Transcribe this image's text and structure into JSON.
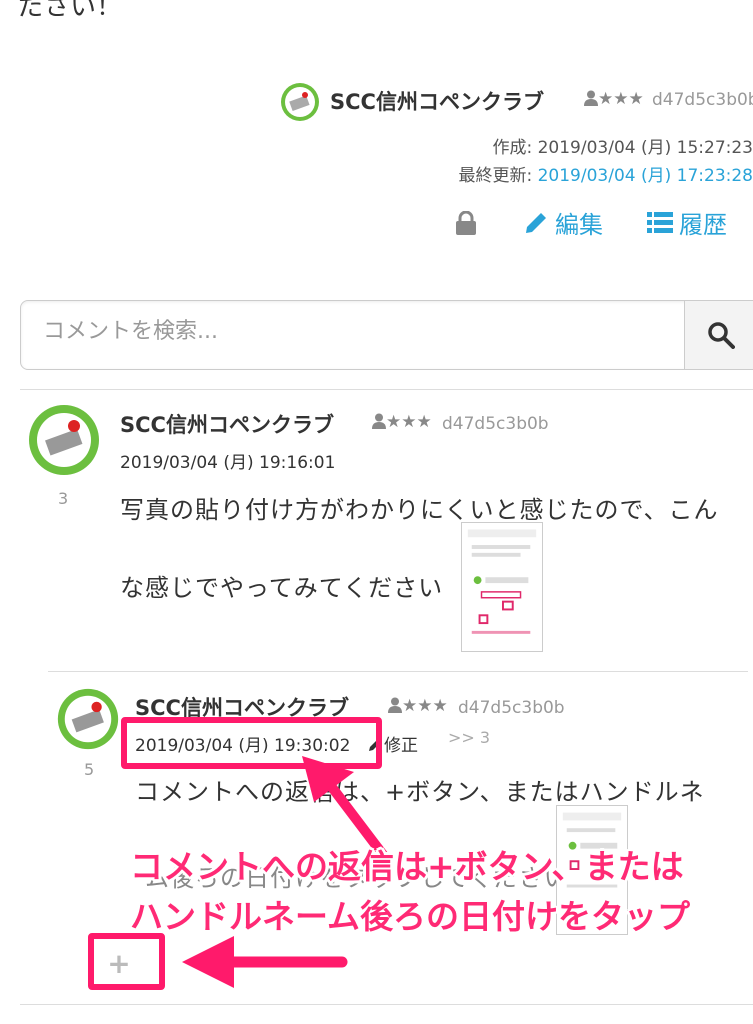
{
  "page": {
    "top_text": "ださい！"
  },
  "post_author": {
    "name": "SCC信州コペンクラブ",
    "badge": "★★★",
    "id": "d47d5c3b0b",
    "created_label": "作成: ",
    "created_value": "2019/03/04 (月) 15:27:23",
    "updated_label": "最終更新: ",
    "updated_value": "2019/03/04 (月) 17:23:28"
  },
  "actions": {
    "lock_icon": "lock-icon",
    "edit_label": "編集",
    "history_label": "履歴"
  },
  "search": {
    "placeholder": "コメントを検索...",
    "icon": "search-icon"
  },
  "comments": [
    {
      "name": "SCC信州コペンクラブ",
      "badge": "★★★",
      "id": "d47d5c3b0b",
      "date": "2019/03/04 (月) 19:16:01",
      "count": "3",
      "body_line1": "写真の貼り付け方がわかりにくいと感じたので、こん",
      "body_line2": "な感じでやってみてください"
    },
    {
      "name": "SCC信州コペンクラブ",
      "badge": "★★★",
      "id": "d47d5c3b0b",
      "date": "2019/03/04 (月) 19:30:02",
      "edit_label": "修正",
      "reply_ref": ">> 3",
      "count": "5",
      "body_line1": "コメントへの返信は、+ボタン、またはハンドルネ",
      "body_line2": "ム後ろの日付けをタップしてください"
    }
  ],
  "annotation": {
    "line1": "コメントへの返信は+ボタン、または",
    "line2": "ハンドルネーム後ろの日付けをタップ",
    "color": "#ff2a75"
  },
  "reply_button": {
    "label": "+"
  }
}
